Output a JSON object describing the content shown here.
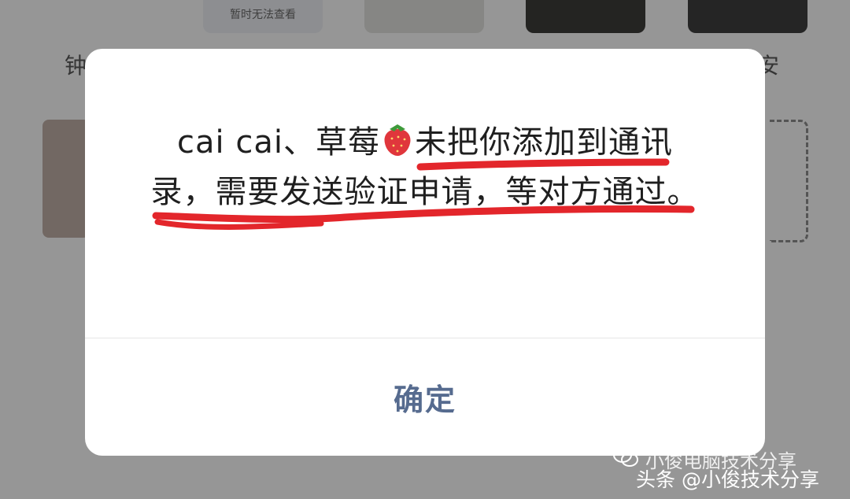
{
  "background": {
    "thumb_caption": "暂时无法查看",
    "left_label": "钟",
    "right_label": "安"
  },
  "dialog": {
    "message_prefix": "cai cai、草莓",
    "message_suffix": "未把你添加到通讯录，需要发送验证申请，等对方通过。",
    "confirm_label": "确定"
  },
  "watermark": {
    "line1": "小俊电脑技术分享",
    "line2": "头条 @小俊技术分享"
  },
  "colors": {
    "confirm_text": "#566b8f",
    "annotation_underline": "#e3262b"
  }
}
